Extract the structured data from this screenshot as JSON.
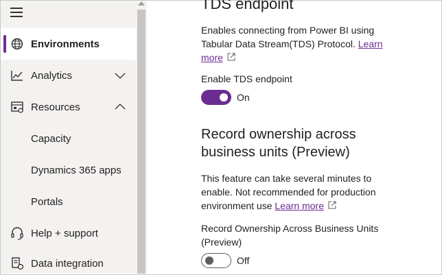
{
  "sidebar": {
    "menu_icon": "hamburger-menu-icon",
    "items": [
      {
        "label": "Environments",
        "icon": "globe-icon",
        "active": true
      },
      {
        "label": "Analytics",
        "icon": "chart-line-icon",
        "expand": "chevron-down-icon"
      },
      {
        "label": "Resources",
        "icon": "resources-icon",
        "expand": "chevron-up-icon"
      },
      {
        "label": "Capacity"
      },
      {
        "label": "Dynamics 365 apps"
      },
      {
        "label": "Portals"
      },
      {
        "label": "Help + support",
        "icon": "headset-icon"
      },
      {
        "label": "Data integration",
        "icon": "data-integration-icon"
      }
    ]
  },
  "tds": {
    "heading": "TDS endpoint",
    "description_line1": "Enables connecting from Power BI using",
    "description_line2": "Tabular Data Stream(TDS) Protocol.",
    "learn_more_1": "Learn",
    "learn_more_2": "more",
    "setting_label": "Enable TDS endpoint",
    "toggle_state": "On"
  },
  "record_ownership": {
    "heading_line1": "Record ownership across",
    "heading_line2": "business units (Preview)",
    "description_line1": "This feature can take several minutes to",
    "description_line2": "enable. Not recommended for production",
    "description_line3": "environment use",
    "learn_more": "Learn more",
    "setting_label_line1": "Record Ownership Across Business Units",
    "setting_label_line2": "(Preview)",
    "toggle_state": "Off"
  },
  "colors": {
    "accent": "#6b2c91",
    "highlight": "#e01e24",
    "sidebar_bg": "#f3f2f1"
  }
}
